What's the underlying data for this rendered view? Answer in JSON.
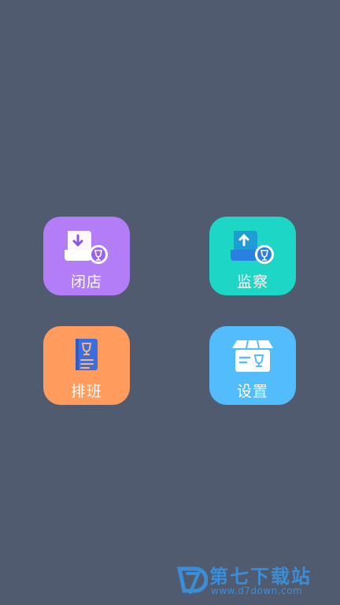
{
  "menu": {
    "tiles": [
      {
        "label": "闭店",
        "icon": "store-close-icon",
        "color": "#b27df7"
      },
      {
        "label": "监察",
        "icon": "monitor-icon",
        "color": "#1dd6c6"
      },
      {
        "label": "排班",
        "icon": "schedule-icon",
        "color": "#ff9b5d"
      },
      {
        "label": "设置",
        "icon": "settings-box-icon",
        "color": "#53bcfb"
      }
    ]
  },
  "watermark": {
    "title": "第七下载站",
    "url": "www.d7down.com",
    "color": "#3a8ed8"
  }
}
